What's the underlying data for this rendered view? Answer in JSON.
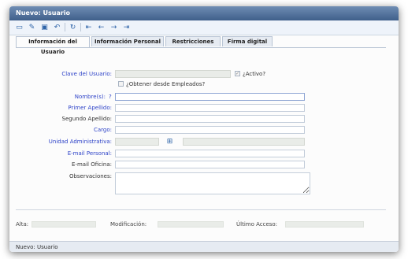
{
  "window": {
    "title": "Nuevo: Usuario"
  },
  "toolbar": {
    "icons": [
      "new-doc-icon",
      "edit-doc-icon",
      "save-icon",
      "undo-icon",
      "refresh-icon",
      "first-record-icon",
      "prev-record-icon",
      "next-record-icon",
      "last-record-icon"
    ]
  },
  "tabs": [
    "Información del Usuario",
    "Información Personal",
    "Restricciones",
    "Firma digital"
  ],
  "form": {
    "clave_label": "Clave del Usuario:",
    "activo_label": "¿Activo?",
    "obtener_label": "¿Obtener desde Empleados?",
    "nombre_label": "Nombre(s):",
    "help_mark": "?",
    "primer_apellido_label": "Primer Apellido:",
    "segundo_apellido_label": "Segundo Apellido:",
    "cargo_label": "Cargo:",
    "unidad_label": "Unidad Administrativa:",
    "email_personal_label": "E-mail Personal:",
    "email_oficina_label": "E-mail Oficina:",
    "observaciones_label": "Observaciones:",
    "values": {
      "clave": "",
      "nombre": "",
      "primer_apellido": "",
      "segundo_apellido": "",
      "cargo": "",
      "unidad_code": "",
      "unidad_name": "",
      "email_personal": "",
      "email_oficina": "",
      "observaciones": ""
    }
  },
  "status": {
    "alta_label": "Alta:",
    "modificacion_label": "Modificación:",
    "ultimo_acceso_label": "Último Acceso:"
  },
  "footer": {
    "text": "Nuevo: Usuario"
  },
  "colors": {
    "label_blue": "#2e43c8",
    "titlebar": "#4b6a95"
  }
}
